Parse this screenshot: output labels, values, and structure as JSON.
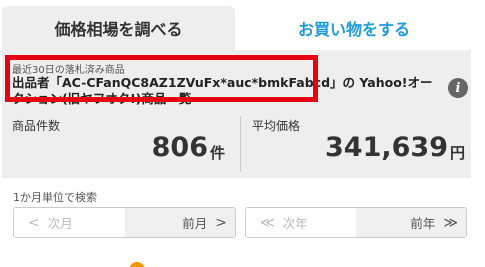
{
  "tabs": {
    "price_search": "価格相場を調べる",
    "shopping": "お買い物をする"
  },
  "header": {
    "crumb": "最近30日の落札済み商品",
    "title": "出品者「AC-CFanQC8AZ1ZVuFx*auc*bmkFabcd」の Yahoo!オークション(旧ヤフオク!)商品一覧",
    "info_icon": "info-icon"
  },
  "stats": {
    "count_label": "商品件数",
    "count_value": "806",
    "count_unit": "件",
    "avg_label": "平均価格",
    "avg_value": "341,639",
    "avg_unit": "円"
  },
  "period": {
    "label": "1か月単位で検索",
    "prev_month": "次月",
    "next_month": "前月",
    "prev_year": "次年",
    "next_year": "前年"
  },
  "colors": {
    "accent": "#1e9bdd",
    "highlight": "#e60012",
    "panel": "#eeeeee"
  }
}
